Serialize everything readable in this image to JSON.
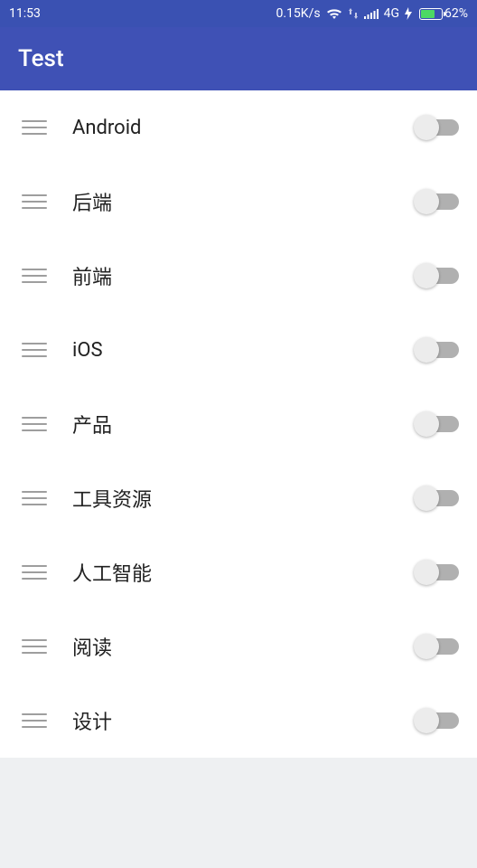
{
  "status_bar": {
    "time": "11:53",
    "speed": "0.15K/s",
    "network": "4G",
    "battery_pct": "62%"
  },
  "app_bar": {
    "title": "Test"
  },
  "items": [
    {
      "label": "Android"
    },
    {
      "label": "后端"
    },
    {
      "label": "前端"
    },
    {
      "label": "iOS"
    },
    {
      "label": "产品"
    },
    {
      "label": "工具资源"
    },
    {
      "label": "人工智能"
    },
    {
      "label": "阅读"
    },
    {
      "label": "设计"
    }
  ]
}
